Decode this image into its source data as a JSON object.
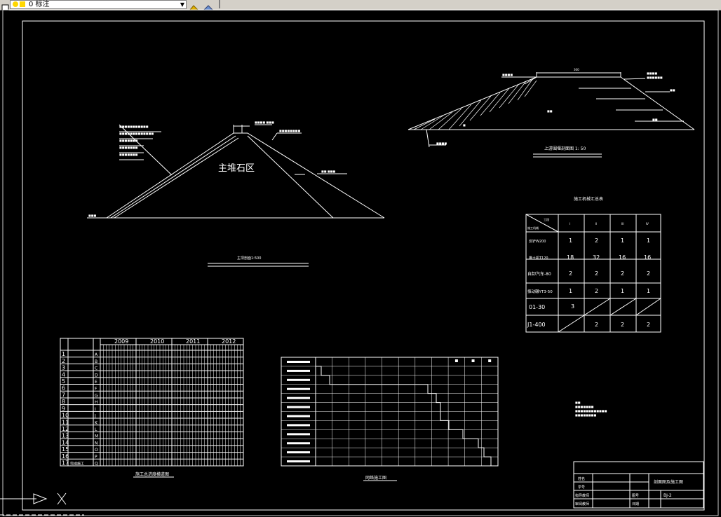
{
  "toolbar": {
    "layer_name": "0 标注"
  },
  "dam_section": {
    "zone_label": "主堆石区",
    "caption": "主坝剖面1:500"
  },
  "cofferdam": {
    "caption": "上游围堰剖面图 1: 50",
    "crest_width": "300"
  },
  "machine_table": {
    "title": "施工机械汇总表",
    "headers": [
      "工段",
      "I",
      "II",
      "III",
      "IV"
    ],
    "header_row_label": "施工机械",
    "rows": [
      {
        "name": "反铲W200",
        "values": [
          "1",
          "2",
          "1",
          "1"
        ]
      },
      {
        "name": "推土机T120",
        "values": [
          "18",
          "32",
          "16",
          "16"
        ]
      },
      {
        "name": "自卸汽车-80",
        "values": [
          "2",
          "2",
          "2",
          "2"
        ]
      },
      {
        "name": "振动碾YT3-50",
        "values": [
          "1",
          "2",
          "1",
          "1"
        ]
      },
      {
        "name": "01-30",
        "values": [
          "3",
          "",
          "",
          ""
        ]
      },
      {
        "name": "J1-400",
        "values": [
          "",
          "2",
          "2",
          "2"
        ]
      }
    ]
  },
  "schedule": {
    "caption": "施工总进度横道图",
    "years": [
      "2009",
      "2010",
      "2011",
      "2012"
    ],
    "row_numbers": [
      "1",
      "2",
      "3",
      "4",
      "5",
      "6",
      "7",
      "8",
      "9",
      "10",
      "11",
      "12",
      "13",
      "14",
      "15",
      "16",
      "17"
    ],
    "row_codes": [
      "A",
      "B",
      "C",
      "D",
      "E",
      "F",
      "G",
      "H",
      "I",
      "J",
      "K",
      "L",
      "M",
      "N",
      "O",
      "P",
      "Q"
    ],
    "last_row_label": "完成施工"
  },
  "network": {
    "caption": "网络施工图"
  },
  "title_block": {
    "drawing_name": "剖面图及施工图",
    "drawing_no": "BJ-2",
    "fields": [
      "姓名",
      "学号",
      "指导教师",
      "审阅教师",
      "图号",
      "日期"
    ]
  },
  "colors": {
    "background": "#000000",
    "line": "#ffffff",
    "toolbar": "#d4d0c8"
  }
}
